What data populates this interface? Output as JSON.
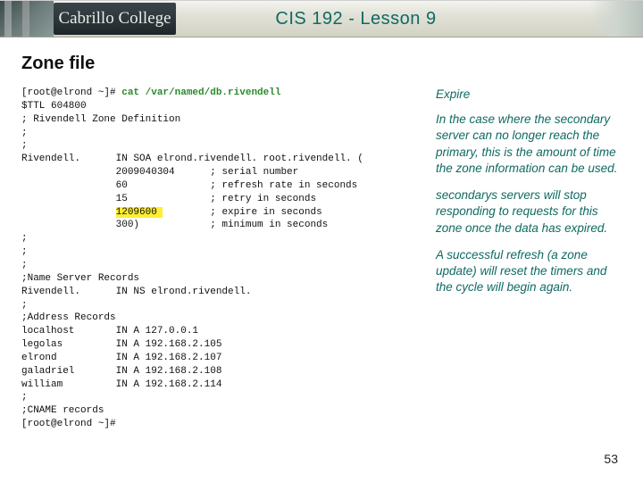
{
  "header": {
    "logo_text": "Cabrillo College",
    "title": "CIS 192 - Lesson 9"
  },
  "section_title": "Zone file",
  "code": {
    "prompt1": "[root@elrond ~]# ",
    "command": "cat /var/named/db.rivendell",
    "l2": "$TTL 604800",
    "l3": "; Rivendell Zone Definition",
    "l4": ";",
    "l5": ";",
    "l6": "Rivendell.      IN SOA elrond.rivendell. root.rivendell. (",
    "l7": "                2009040304      ; serial number",
    "l8": "                60              ; refresh rate in seconds",
    "l9": "                15              ; retry in seconds",
    "l10a": "                ",
    "l10h": "1209600 ",
    "l10b": "        ; expire in seconds",
    "l11": "                300)            ; minimum in seconds",
    "l12": ";",
    "l13": ";",
    "l14": ";",
    "l15": ";Name Server Records",
    "l16": "Rivendell.      IN NS elrond.rivendell.",
    "l17": ";",
    "l18": ";Address Records",
    "l19": "localhost       IN A 127.0.0.1",
    "l20": "legolas         IN A 192.168.2.105",
    "l21": "elrond          IN A 192.168.2.107",
    "l22": "galadriel       IN A 192.168.2.108",
    "l23": "william         IN A 192.168.2.114",
    "l24": ";",
    "l25": ";CNAME records",
    "l26": "[root@elrond ~]#"
  },
  "right": {
    "heading": "Expire",
    "p1": "In the case where the secondary server can no longer reach the primary, this is the amount of time the zone information can be used.",
    "p2": "secondarys servers will stop responding to requests for this zone once the data has expired.",
    "p3": "A successful refresh (a zone update) will reset the timers and the cycle will begin again."
  },
  "page_number": "53"
}
